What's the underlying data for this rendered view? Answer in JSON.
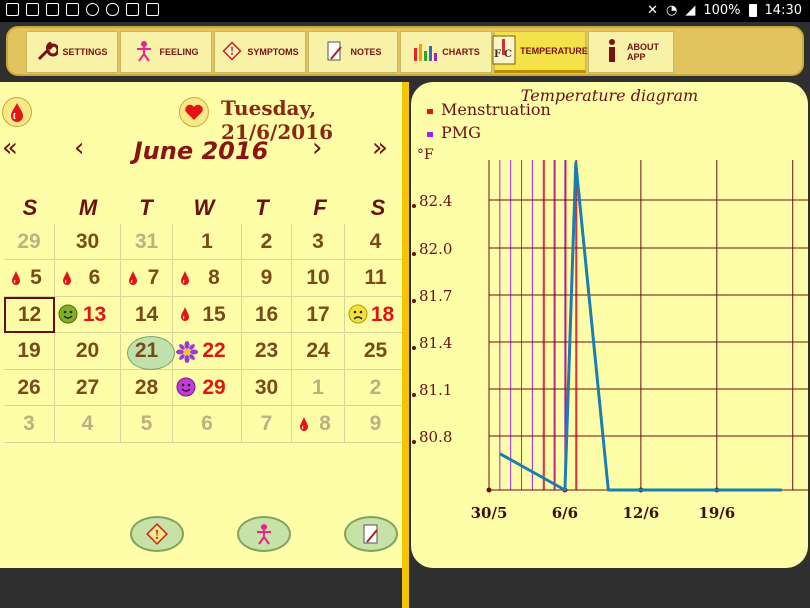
{
  "status_bar": {
    "battery": "100%",
    "time": "14:30"
  },
  "toolbar": {
    "items": [
      {
        "label": "SETTINGS",
        "icon": "wrench-icon"
      },
      {
        "label": "FEELING",
        "icon": "figure-icon"
      },
      {
        "label": "SYMPTOMS",
        "icon": "warning-icon"
      },
      {
        "label": "NOTES",
        "icon": "notepad-icon"
      },
      {
        "label": "CHARTS",
        "icon": "bar-chart-icon"
      },
      {
        "label": "TEMPERATURE",
        "icon": "thermometer-fc-icon"
      },
      {
        "label": "ABOUT APP",
        "icon": "info-icon"
      }
    ],
    "active": "TEMPERATURE"
  },
  "calendar": {
    "selected_date_text": "Tuesday, 21/6/2016",
    "month_title": "June 2016",
    "nav": {
      "prev_year": "«",
      "prev_month": "‹",
      "next_month": "›",
      "next_year": "»"
    },
    "weekdays": [
      "S",
      "M",
      "T",
      "W",
      "T",
      "F",
      "S"
    ],
    "weeks": [
      [
        {
          "d": "29",
          "other": true
        },
        {
          "d": "30"
        },
        {
          "d": "31",
          "other": true
        },
        {
          "d": "1"
        },
        {
          "d": "2"
        },
        {
          "d": "3"
        },
        {
          "d": "4"
        }
      ],
      [
        {
          "d": "5",
          "icon": "drop"
        },
        {
          "d": "6",
          "icon": "drop"
        },
        {
          "d": "7",
          "icon": "drop"
        },
        {
          "d": "8",
          "icon": "drop"
        },
        {
          "d": "9"
        },
        {
          "d": "10"
        },
        {
          "d": "11"
        }
      ],
      [
        {
          "d": "12",
          "selected": true
        },
        {
          "d": "13",
          "red": true,
          "icon": "smile-green"
        },
        {
          "d": "14"
        },
        {
          "d": "15",
          "icon": "drop"
        },
        {
          "d": "16"
        },
        {
          "d": "17"
        },
        {
          "d": "18",
          "red": true,
          "icon": "sad-yellow"
        }
      ],
      [
        {
          "d": "19"
        },
        {
          "d": "20"
        },
        {
          "d": "21",
          "today": true
        },
        {
          "d": "22",
          "red": true,
          "icon": "flower"
        },
        {
          "d": "23"
        },
        {
          "d": "24"
        },
        {
          "d": "25"
        }
      ],
      [
        {
          "d": "26"
        },
        {
          "d": "27"
        },
        {
          "d": "28"
        },
        {
          "d": "29",
          "red": true,
          "icon": "smile-purple"
        },
        {
          "d": "30"
        },
        {
          "d": "1",
          "other": true
        },
        {
          "d": "2",
          "other": true
        }
      ],
      [
        {
          "d": "3",
          "other": true
        },
        {
          "d": "4",
          "other": true
        },
        {
          "d": "5",
          "other": true
        },
        {
          "d": "6",
          "other": true
        },
        {
          "d": "7",
          "other": true
        },
        {
          "d": "8",
          "other": true,
          "icon": "drop"
        },
        {
          "d": "9",
          "other": true
        }
      ]
    ]
  },
  "bottom_buttons": [
    "warning-icon",
    "figure-icon",
    "notepad-icon"
  ],
  "chart_data": {
    "type": "line",
    "title": "Temperature diagram",
    "ylabel": "°F",
    "legend": [
      {
        "label": "Menstruation",
        "color": "#e31414"
      },
      {
        "label": "PMG",
        "color": "#a020f0"
      }
    ],
    "y_ticks": [
      "82.4",
      "82.0",
      "81.7",
      "81.4",
      "81.1",
      "80.8"
    ],
    "x_ticks": [
      "30/5",
      "6/6",
      "12/6",
      "19/6"
    ],
    "series": [
      {
        "color": "#1a7fb0",
        "values": [
          {
            "x": 1,
            "y": 80.7
          },
          {
            "x": 7,
            "y": 80.45
          },
          {
            "x": 8,
            "y": 82.7
          },
          {
            "x": 11,
            "y": 80.45
          },
          {
            "x": 27,
            "y": 80.45
          }
        ]
      }
    ],
    "menstruation_days": [
      5,
      6,
      7,
      8
    ],
    "pmg_days": [
      1,
      2,
      3,
      4,
      5,
      6,
      7,
      8
    ]
  }
}
